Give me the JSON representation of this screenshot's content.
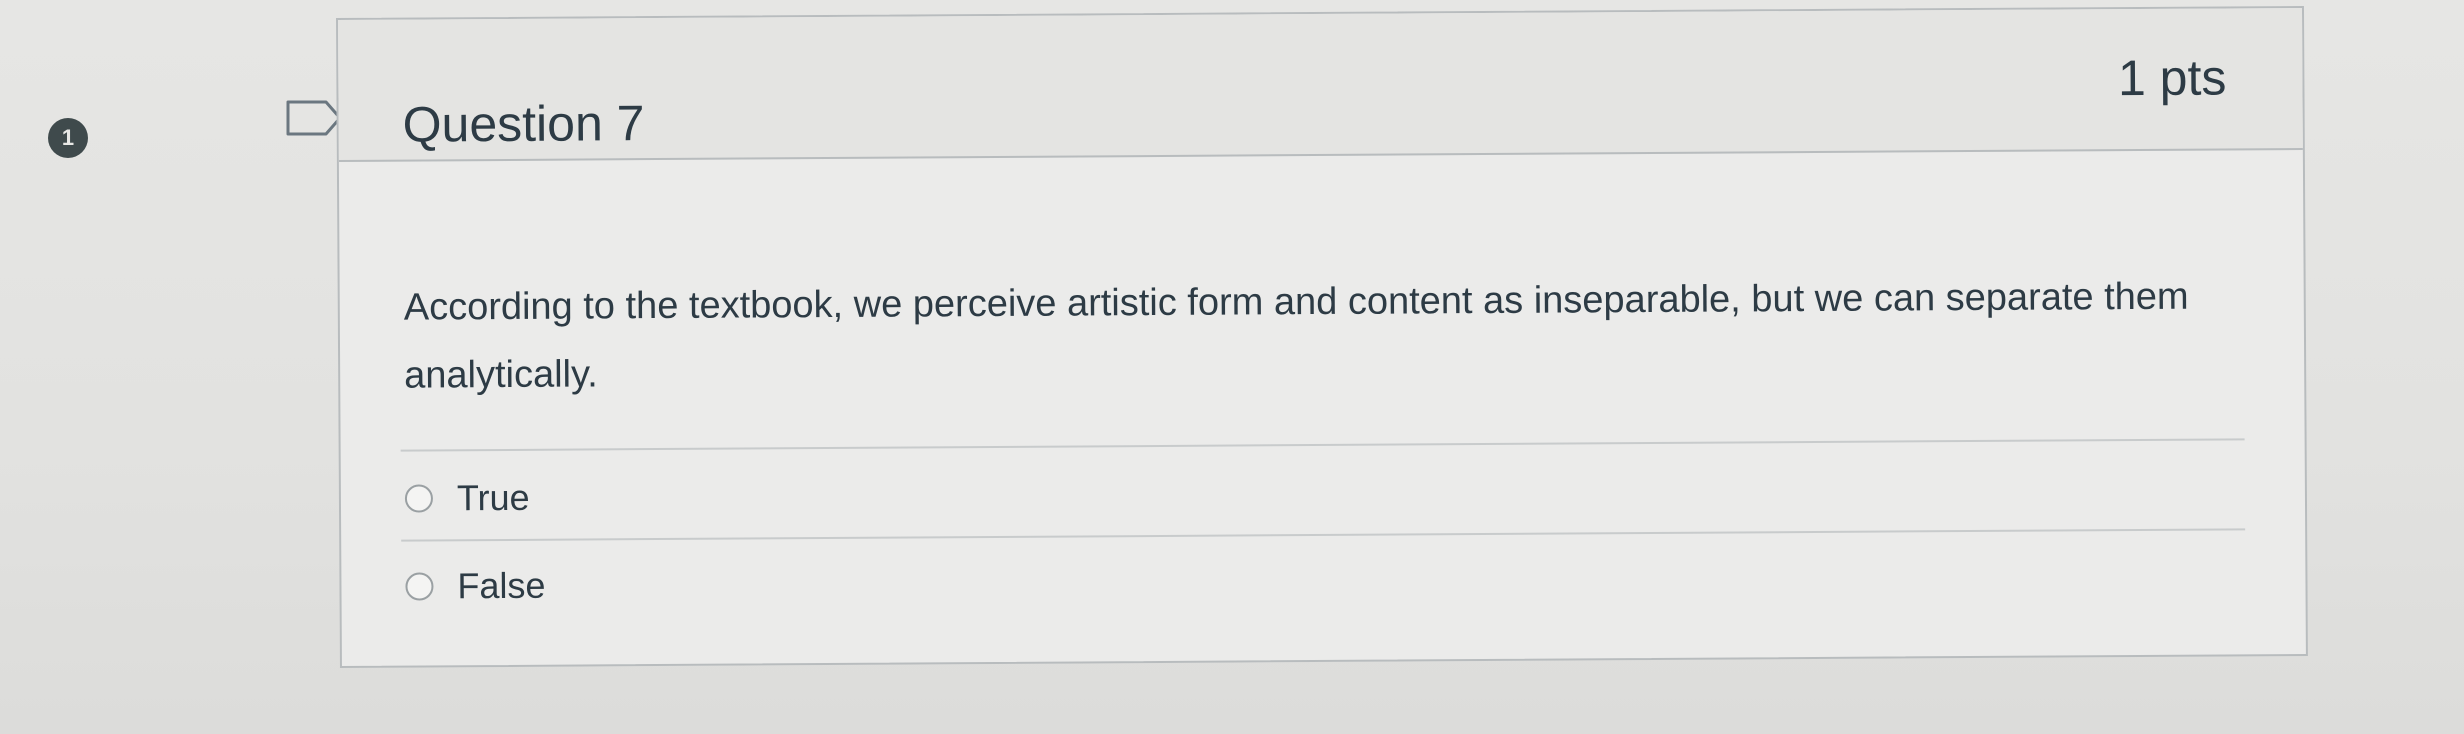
{
  "question": {
    "indicator_number": "1",
    "title": "Question 7",
    "points": "1 pts",
    "text": "According to the textbook, we perceive artistic form and content as inseparable, but we can separate them analytically.",
    "answers": [
      {
        "label": "True"
      },
      {
        "label": "False"
      }
    ]
  }
}
